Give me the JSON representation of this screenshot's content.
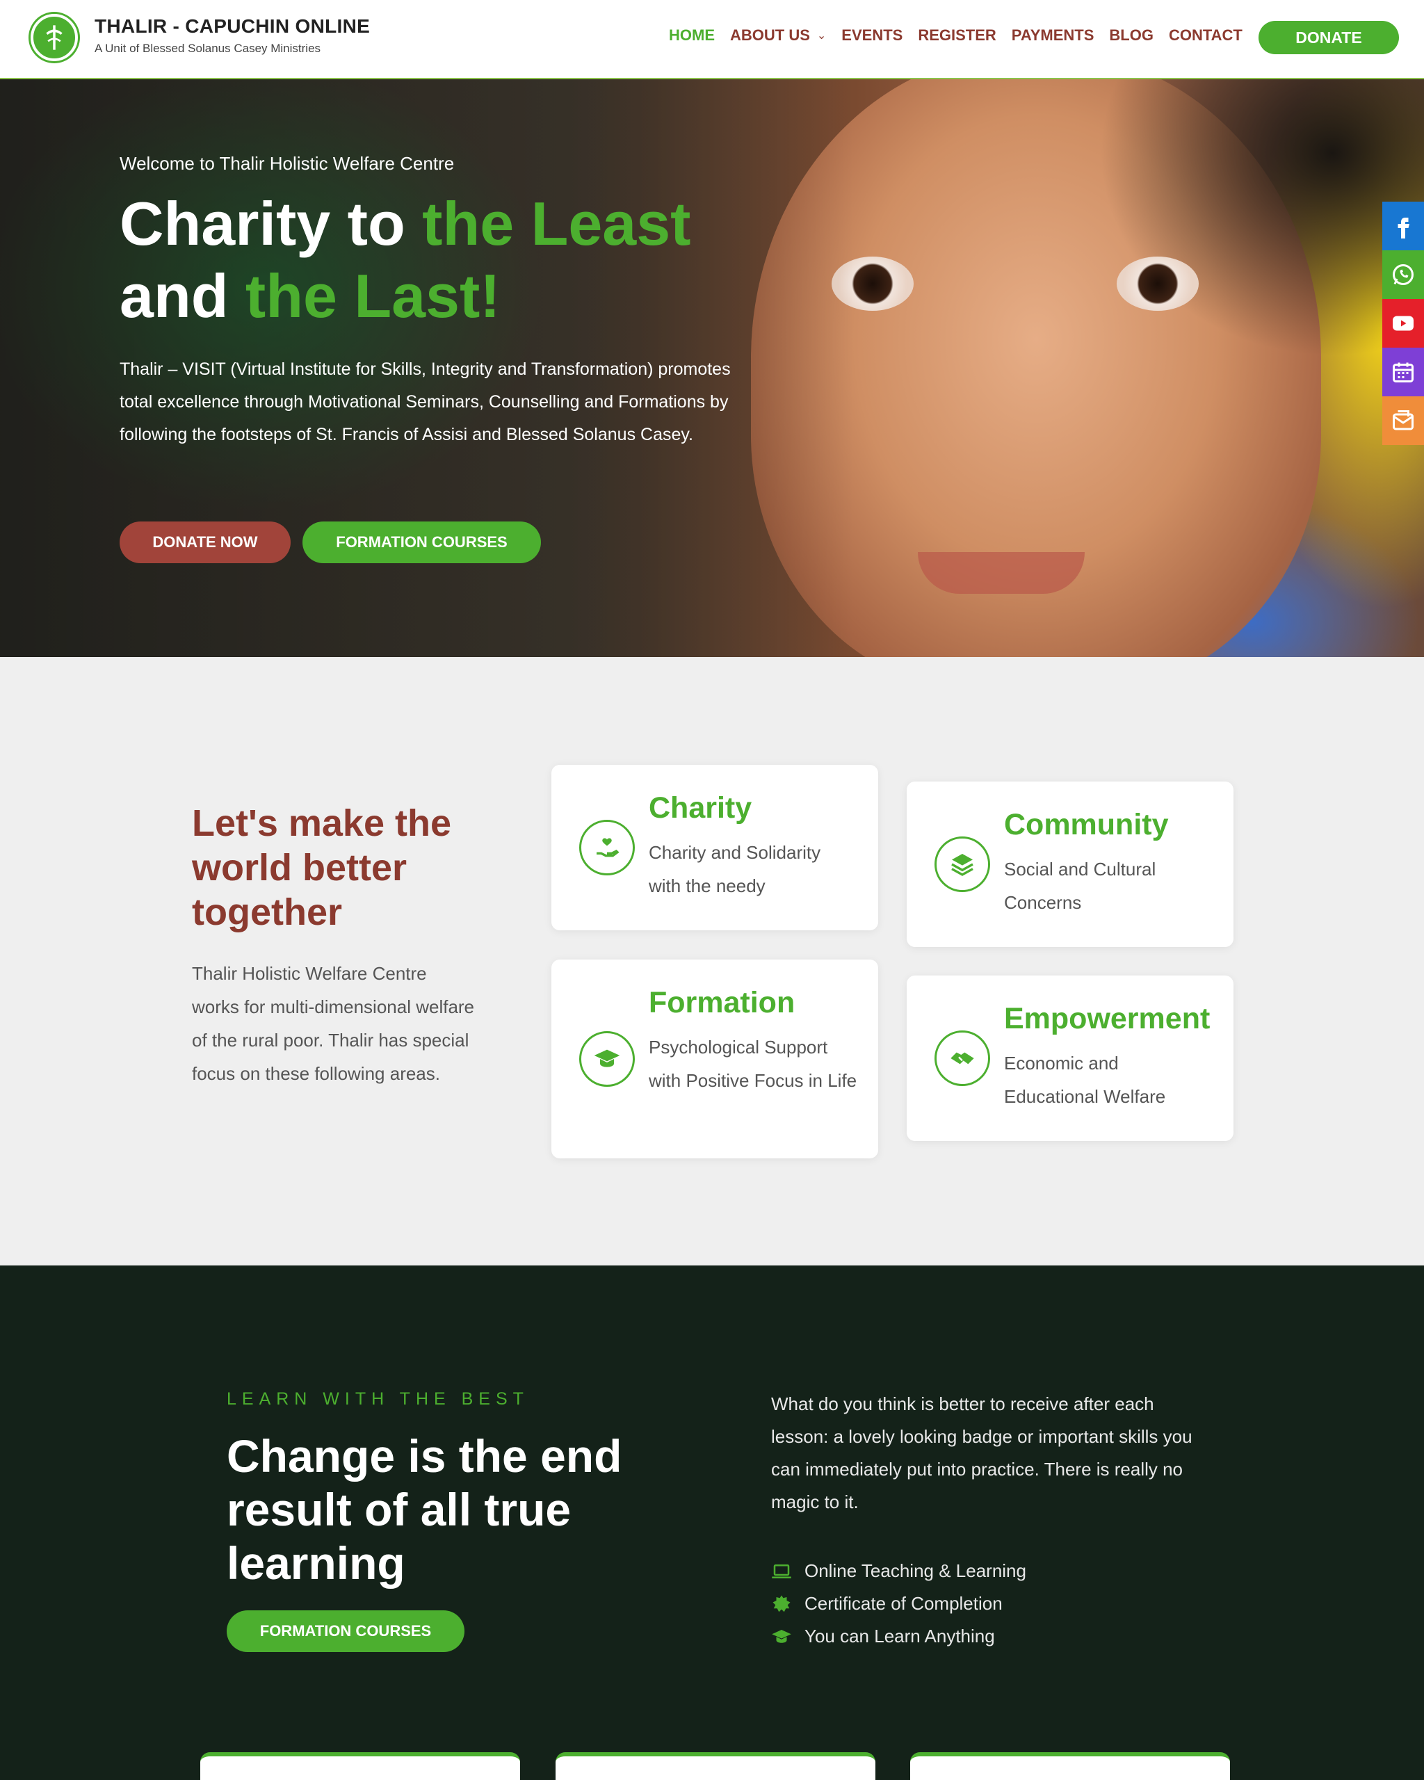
{
  "header": {
    "brand_title": "THALIR - CAPUCHIN ONLINE",
    "brand_subtitle": "A Unit of Blessed Solanus Casey Ministries",
    "nav": [
      "HOME",
      "ABOUT US",
      "EVENTS",
      "REGISTER",
      "PAYMENTS",
      "BLOG",
      "CONTACT"
    ],
    "donate_label": "DONATE"
  },
  "hero": {
    "welcome": "Welcome to Thalir Holistic Welfare Centre",
    "title_part1": "Charity to ",
    "title_green1": "the Least",
    "title_part2": "and ",
    "title_green2": "the Last!",
    "description": "Thalir – VISIT (Virtual Institute for Skills, Integrity and Transformation) promotes total excellence through Motivational Seminars, Counselling and Formations by following the footsteps of St. Francis of Assisi and Blessed Solanus Casey.",
    "btn_donate_now": "DONATE NOW",
    "btn_formation": "FORMATION COURSES"
  },
  "social": {
    "items": [
      {
        "icon": "facebook-icon",
        "color": "#1877d2"
      },
      {
        "icon": "whatsapp-icon",
        "color": "#4caf2f"
      },
      {
        "icon": "youtube-icon",
        "color": "#e5202a"
      },
      {
        "icon": "calendar-icon",
        "color": "#7e3fd6"
      },
      {
        "icon": "mail-icon",
        "color": "#f08d3a"
      }
    ]
  },
  "features": {
    "title": "Let's make the world better together",
    "description": "Thalir Holistic Welfare Centre works for multi-dimensional welfare of the rural poor. Thalir has special focus on these following areas.",
    "cards": [
      {
        "title": "Charity",
        "text": "Charity and Solidarity with the needy",
        "icon": "heart-hand-icon"
      },
      {
        "title": "Community",
        "text": "Social and Cultural Concerns",
        "icon": "layers-icon"
      },
      {
        "title": "Formation",
        "text": "Psychological Support with Positive Focus in Life",
        "icon": "graduation-cap-icon"
      },
      {
        "title": "Empowerment",
        "text": "Economic and Educational Welfare",
        "icon": "handshake-icon"
      }
    ]
  },
  "learn": {
    "kicker": "LEARN WITH THE BEST",
    "title": "Change is the end result of all true learning",
    "button": "FORMATION COURSES",
    "description": "What do you think is better to receive after each lesson: a lovely looking badge or important skills you can immediately put into practice. There is really no magic to it.",
    "list": [
      {
        "text": "Online Teaching & Learning",
        "icon": "laptop-icon"
      },
      {
        "text": "Certificate of Completion",
        "icon": "badge-icon"
      },
      {
        "text": "You can Learn Anything",
        "icon": "graduation-cap-icon"
      }
    ]
  },
  "colors": {
    "brand_green": "#4caf2f",
    "brand_maroon": "#8b3a2f",
    "button_red": "#a1443a",
    "dark_section": "#142219"
  }
}
